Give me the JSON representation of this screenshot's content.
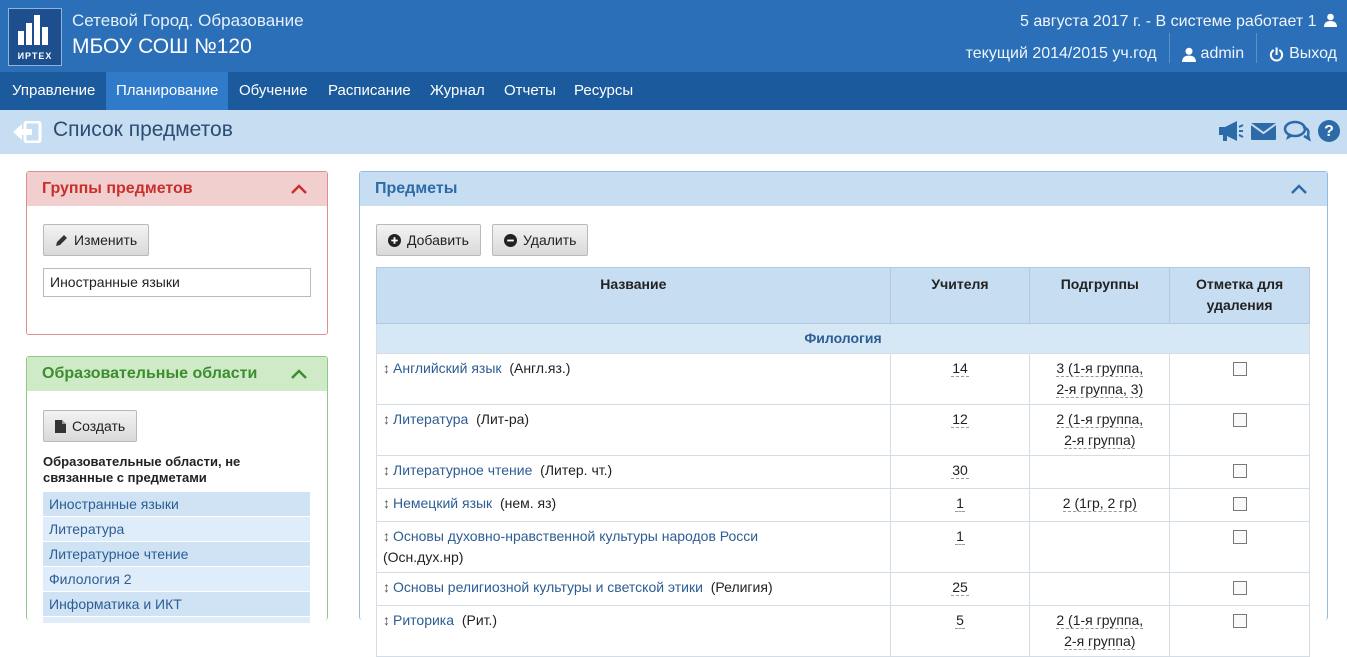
{
  "header": {
    "logo_text": "ИРТЕХ",
    "app_name": "Сетевой Город. Образование",
    "school": "МБОУ СОШ №120",
    "date_status": "5 августа 2017 г. - В системе работает 1",
    "year": "текущий 2014/2015 уч.год",
    "user": "admin",
    "logout": "Выход"
  },
  "nav": [
    "Управление",
    "Планирование",
    "Обучение",
    "Расписание",
    "Журнал",
    "Отчеты",
    "Ресурсы"
  ],
  "nav_active": "Планирование",
  "page": {
    "title": "Список предметов"
  },
  "groups_panel": {
    "title": "Группы предметов",
    "edit_label": "Изменить",
    "selected_group": "Иностранные языки"
  },
  "areas_panel": {
    "title": "Образовательные области",
    "create_label": "Создать",
    "note": "Образовательные области, не связанные с предметами",
    "items": [
      "Иностранные языки",
      "Литература",
      "Литературное чтение",
      "Филология 2",
      "Информатика и ИКТ"
    ]
  },
  "subjects_panel": {
    "title": "Предметы",
    "add_label": "Добавить",
    "delete_label": "Удалить",
    "columns": [
      "Название",
      "Учителя",
      "Подгруппы",
      "Отметка для удаления"
    ],
    "group_name": "Филология",
    "rows": [
      {
        "name": "Английский язык",
        "abbr": "(Англ.яз.)",
        "teachers": "14",
        "subgroups": [
          "3 (1-я группа,",
          "2-я группа,  3)"
        ]
      },
      {
        "name": "Литература",
        "abbr": "(Лит-ра)",
        "teachers": "12",
        "subgroups": [
          "2 (1-я группа,",
          "2-я группа)"
        ]
      },
      {
        "name": "Литературное чтение",
        "abbr": "(Литер. чт.)",
        "teachers": "30",
        "subgroups": []
      },
      {
        "name": "Немецкий язык",
        "abbr": "(нем. яз)",
        "teachers": "1",
        "subgroups": [
          "2 (1гр,  2 гр)"
        ]
      },
      {
        "name": "Основы духовно-нравственной культуры народов Росси",
        "abbr": "(Осн.дух.нр)",
        "teachers": "1",
        "subgroups": []
      },
      {
        "name": "Основы религиозной культуры и светской этики",
        "abbr": "(Религия)",
        "teachers": "25",
        "subgroups": []
      },
      {
        "name": "Риторика",
        "abbr": "(Рит.)",
        "teachers": "5",
        "subgroups": [
          "2 (1-я группа,",
          "2-я группа)"
        ]
      }
    ]
  },
  "colors": {
    "header_bg": "#2a6fb7",
    "nav_bg": "#1b5a9d",
    "nav_active": "#2f7bca",
    "groups_accent": "#c9302c",
    "areas_accent": "#3c8d2f",
    "subjects_accent": "#2c6aa8"
  }
}
